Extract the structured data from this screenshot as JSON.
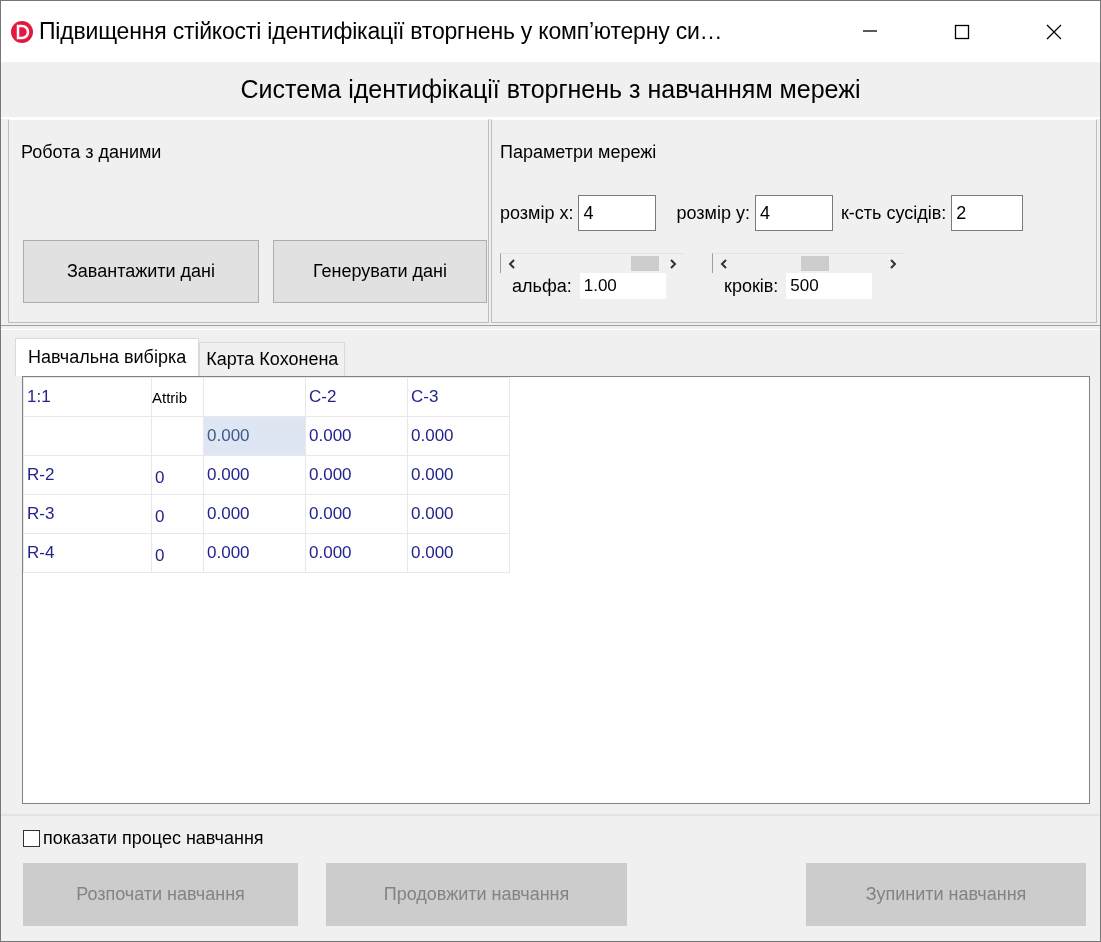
{
  "window": {
    "title": "Підвищення стійкості ідентифікації вторгнень у комп’ютерну си…"
  },
  "header": {
    "title": "Система ідентифікації вторгнень з навчанням мережі"
  },
  "data_panel": {
    "title": "Робота з даними",
    "buttons": [
      {
        "label": "Завантажити дані",
        "disabled": false
      },
      {
        "label": "Генерувати дані",
        "disabled": false
      }
    ]
  },
  "network_panel": {
    "title": "Параметри мережі",
    "fields": [
      {
        "label": "розмір x:",
        "value": "4"
      },
      {
        "label": "розмір y:",
        "value": "4"
      },
      {
        "label": "к-сть сусідів:",
        "value": "2"
      }
    ],
    "sliders": [
      {
        "label": "альфа:",
        "reading": "1.00",
        "level": 0.84
      },
      {
        "label": "кроків:",
        "reading": "500",
        "level": 0.54
      }
    ]
  },
  "tabs": [
    {
      "label": "Навчальна вибірка",
      "selected": true
    },
    {
      "label": "Карта Кохонена",
      "selected": false
    }
  ],
  "table": {
    "rows": [
      {
        "cells": [
          {
            "text": "1:1",
            "kind": "fixed",
            "selected": false
          },
          {
            "text": "Attrib",
            "kind": "plain",
            "selected": false
          },
          {
            "kind": "fixed",
            "selected": false
          },
          {
            "text": "C-2",
            "kind": "fixed",
            "selected": false
          },
          {
            "text": "C-3",
            "kind": "fixed",
            "selected": false
          }
        ]
      },
      {
        "cells": [
          {
            "kind": "fixed",
            "selected": false
          },
          {
            "kind": "fixed",
            "selected": false
          },
          {
            "text": "0.000",
            "kind": "value",
            "selected": true
          },
          {
            "text": "0.000",
            "kind": "value",
            "selected": false
          },
          {
            "text": "0.000",
            "kind": "value",
            "selected": false
          }
        ]
      },
      {
        "cells": [
          {
            "text": "R-2",
            "kind": "fixed",
            "selected": false
          },
          {
            "text": "0",
            "kind": "fixed",
            "selected": false
          },
          {
            "text": "0.000",
            "kind": "value",
            "selected": false
          },
          {
            "text": "0.000",
            "kind": "value",
            "selected": false
          },
          {
            "text": "0.000",
            "kind": "value",
            "selected": false
          }
        ]
      },
      {
        "cells": [
          {
            "text": "R-3",
            "kind": "fixed",
            "selected": false
          },
          {
            "text": "0",
            "kind": "fixed",
            "selected": false
          },
          {
            "text": "0.000",
            "kind": "value",
            "selected": false
          },
          {
            "text": "0.000",
            "kind": "value",
            "selected": false
          },
          {
            "text": "0.000",
            "kind": "value",
            "selected": false
          }
        ]
      },
      {
        "cells": [
          {
            "text": "R-4",
            "kind": "fixed",
            "selected": false
          },
          {
            "text": "0",
            "kind": "fixed",
            "selected": false
          },
          {
            "text": "0.000",
            "kind": "value",
            "selected": false
          },
          {
            "text": "0.000",
            "kind": "value",
            "selected": false
          },
          {
            "text": "0.000",
            "kind": "value",
            "selected": false
          }
        ]
      }
    ]
  },
  "show_progress": {
    "label": "показати процес навчання",
    "checked": false
  },
  "actions": [
    {
      "label": "Розпочати навчання",
      "disabled": true
    },
    {
      "label": "Продовжити навчання",
      "disabled": true
    },
    {
      "label": "Зупинити навчання",
      "disabled": true
    }
  ]
}
